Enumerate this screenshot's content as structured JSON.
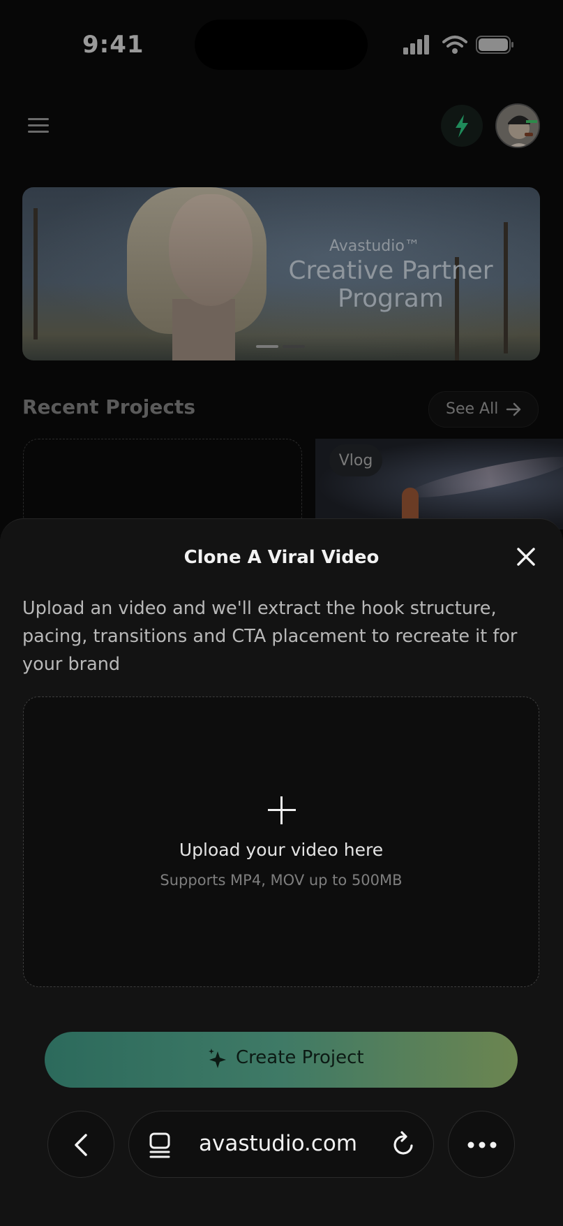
{
  "status_bar": {
    "time": "9:41"
  },
  "top_bar": {
    "menu_icon": "hamburger-icon",
    "credits_icon": "lightning-bolt-icon",
    "avatar": "user-avatar"
  },
  "hero_banner": {
    "brand": "Avastudio™",
    "title": "Creative Partner Program",
    "active_slide": 1,
    "slide_count": 2
  },
  "recent_projects": {
    "title": "Recent Projects",
    "see_all_label": "See All",
    "items": [
      {
        "tag": ""
      },
      {
        "tag": "Vlog"
      }
    ]
  },
  "sheet": {
    "title": "Clone A Viral Video",
    "description": "Upload an video and we'll extract the hook structure, pacing, transitions and CTA placement to recreate it for your brand",
    "upload": {
      "title": "Upload your video here",
      "subtitle": "Supports MP4, MOV up to 500MB"
    },
    "create_button_label": "Create Project"
  },
  "browser_bar": {
    "url": "avastudio.com"
  },
  "colors": {
    "accent_start": "#2c6a5c",
    "accent_end": "#6c8550",
    "bolt": "#1f8a5a"
  }
}
